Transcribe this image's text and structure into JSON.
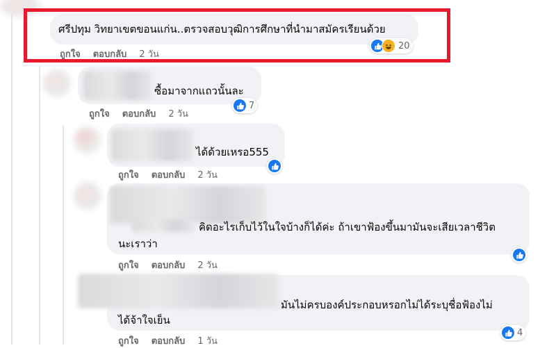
{
  "comments": [
    {
      "text_lines": [
        "ศรีปทุม วิทยาเขตขอนแก่น..ตรวจสอบวุฒิการศึกษาที่นำมาสมัครเรียนด้วย"
      ],
      "like": "ถูกใจ",
      "reply": "ตอบกลับ",
      "time": "2 วัน",
      "reactions": [
        "like-icon",
        "haha-icon"
      ],
      "count": "20"
    },
    {
      "text_lines": [
        "ซื้อมาจากแถวนั้นละ"
      ],
      "like": "ถูกใจ",
      "reply": "ตอบกลับ",
      "time": "2 วัน",
      "reactions": [
        "like-icon"
      ],
      "count": "7"
    },
    {
      "text_lines": [
        "ได้ด้วยเหรอ555"
      ],
      "like": "ถูกใจ",
      "reply": "ตอบกลับ",
      "time": "2 วัน",
      "reactions": [
        "like-icon"
      ],
      "count": ""
    },
    {
      "text_lines": [
        "คิดอะไรเก็บไว้ในใจบ้างก็ได้ค่ะ ถ้าเขาฟ้องขึ้นมามันจะเสียเวลาชีวิต",
        "นะเราว่า"
      ],
      "like": "ถูกใจ",
      "reply": "ตอบกลับ",
      "time": "2 วัน",
      "reactions": [
        "like-icon"
      ],
      "count": ""
    },
    {
      "text_lines": [
        "มันไม่ครบองค์ประกอบหรอกไม่ได้ระบุชื่อฟ้องไม่",
        "ได้จ้าใจเย็น"
      ],
      "like": "ถูกใจ",
      "reply": "ตอบกลับ",
      "time": "1 วัน",
      "reactions": [
        "like-icon"
      ],
      "count": "4"
    }
  ],
  "colors": {
    "highlight": "#e8192c",
    "like": "#1877f2",
    "bubble": "#f0f2f5"
  }
}
